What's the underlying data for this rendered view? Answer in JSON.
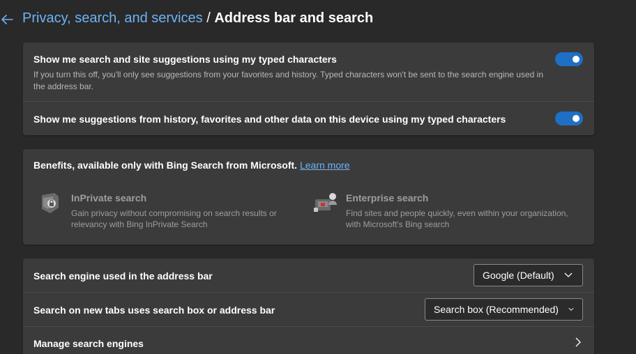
{
  "header": {
    "breadcrumb_parent": "Privacy, search, and services",
    "separator": "/",
    "title": "Address bar and search"
  },
  "suggestions_card": {
    "typed_suggestions": {
      "title": "Show me search and site suggestions using my typed characters",
      "description": "If you turn this off, you'll only see suggestions from your favorites and history. Typed characters won't be sent to the search engine used in the address bar.",
      "enabled": true
    },
    "history_suggestions": {
      "title": "Show me suggestions from history, favorites and other data on this device using my typed characters",
      "enabled": true
    }
  },
  "benefits_card": {
    "heading": "Benefits, available only with Bing Search from Microsoft.",
    "learn_more": "Learn more",
    "inprivate": {
      "title": "InPrivate search",
      "description": "Gain privacy without compromising on search results or relevancy with Bing InPrivate Search"
    },
    "enterprise": {
      "title": "Enterprise search",
      "description": "Find sites and people quickly, even within your organization, with Microsoft's Bing search"
    }
  },
  "search_card": {
    "engine": {
      "label": "Search engine used in the address bar",
      "value": "Google (Default)"
    },
    "new_tabs": {
      "label": "Search on new tabs uses search box or address bar",
      "value": "Search box (Recommended)"
    },
    "manage": {
      "label": "Manage search engines"
    }
  },
  "colors": {
    "accent": "#1f6fc5",
    "link": "#6cb4f5",
    "background": "#292929",
    "card": "#3b3b3b"
  }
}
